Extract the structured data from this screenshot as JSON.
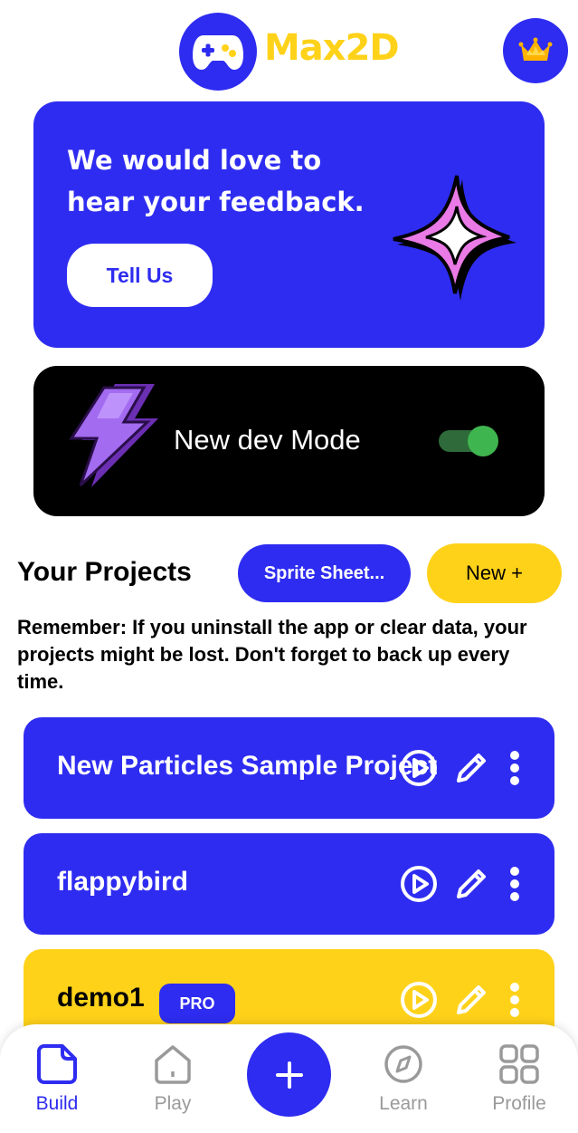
{
  "header": {
    "logo_text": "Max2D"
  },
  "feedback_card": {
    "title": "We would love to hear your feedback.",
    "button_label": "Tell Us"
  },
  "dev_mode": {
    "label": "New dev Mode",
    "enabled": true
  },
  "projects_section": {
    "title": "Your Projects",
    "sprite_sheet_button": "Sprite Sheet...",
    "new_button": "New +",
    "reminder": "Remember: If you uninstall the app or clear data, your projects might be lost. Don't forget to back up every time."
  },
  "projects": [
    {
      "name": "New Particles Sample Project",
      "color": "blue"
    },
    {
      "name": "flappybird",
      "color": "blue"
    },
    {
      "name": "demo1",
      "color": "yellow",
      "badge": "PRO"
    }
  ],
  "bottom_nav": {
    "items": [
      {
        "label": "Build",
        "icon": "build-icon",
        "active": true
      },
      {
        "label": "Play",
        "icon": "home-icon",
        "active": false
      },
      {
        "label": "Learn",
        "icon": "compass-icon",
        "active": false
      },
      {
        "label": "Profile",
        "icon": "grid-icon",
        "active": false
      }
    ],
    "fab_icon": "plus-icon"
  },
  "colors": {
    "primary_blue": "#2e2cf0",
    "accent_yellow": "#ffd21a",
    "toggle_green": "#3fb54f",
    "inactive_gray": "#9a9a9a"
  }
}
